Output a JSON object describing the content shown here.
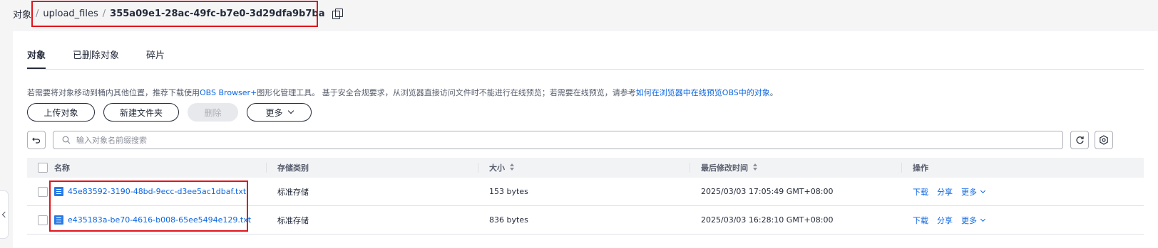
{
  "breadcrumb": {
    "root": "对象",
    "separator": "/",
    "folder": "upload_files",
    "current": "355a09e1-28ac-49fc-b7e0-3d29dfa9b7ba"
  },
  "tabs": [
    "对象",
    "已删除对象",
    "碎片"
  ],
  "tip": {
    "text": "若需要将对象移动到桶内其他位置，推荐下载使用",
    "link1": "OBS Browser+",
    "text2": "图形化管理工具。 基于安全合规要求，从浏览器直接访问文件时不能进行在线预览；若需要在线预览，请参考",
    "link2": "如何在浏览器中在线预览OBS中的对象",
    "text3": "。"
  },
  "toolbar": {
    "upload": "上传对象",
    "new_folder": "新建文件夹",
    "delete": "删除",
    "more": "更多"
  },
  "search": {
    "placeholder": "输入对象名前缀搜索"
  },
  "table": {
    "headers": {
      "name": "名称",
      "storage_class": "存储类别",
      "size": "大小",
      "modified": "最后修改时间",
      "ops": "操作"
    },
    "rows": [
      {
        "name": "45e83592-3190-48bd-9ecc-d3ee5ac1dbaf.txt",
        "storage_class": "标准存储",
        "size": "153 bytes",
        "modified": "2025/03/03 17:05:49 GMT+08:00",
        "download": "下载",
        "share": "分享",
        "more": "更多"
      },
      {
        "name": "e435183a-be70-4616-b008-65ee5494e129.txt",
        "storage_class": "标准存储",
        "size": "836 bytes",
        "modified": "2025/03/03 16:28:10 GMT+08:00",
        "download": "下载",
        "share": "分享",
        "more": "更多"
      }
    ]
  },
  "colors": {
    "link": "#0e67e2",
    "highlight": "#e1141b",
    "file_icon": "#2a7be4"
  }
}
